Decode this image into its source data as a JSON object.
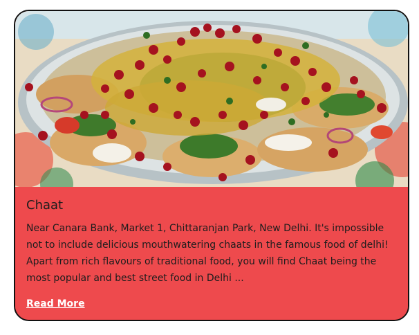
{
  "card": {
    "image_subject": "chaat-dish-photo",
    "title": "Chaat",
    "description": "Near Canara Bank, Market 1, Chittaranjan Park, New Delhi. It's impossible not to include delicious mouthwatering chaats in the famous food of delhi! Apart from rich flavours of traditional food, you will find Chaat being the most popular and best street food in Delhi ...",
    "read_more_label": "Read More"
  },
  "colors": {
    "card_background": "#ee4a4d",
    "card_border": "#111111",
    "text": "#1d1d1d",
    "link": "#ffffff"
  }
}
